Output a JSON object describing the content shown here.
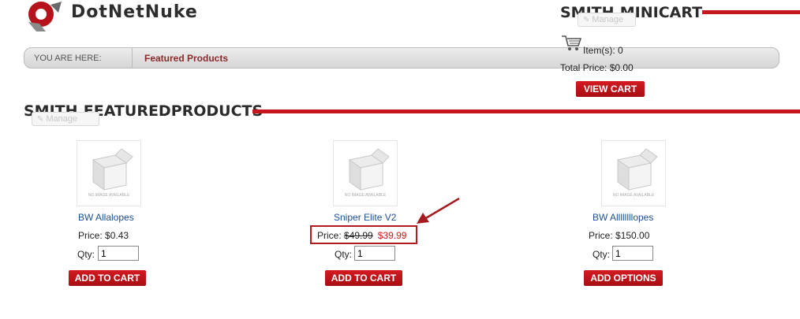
{
  "logo": {
    "text": "DotNetNuke"
  },
  "breadcrumb": {
    "label": "YOU ARE HERE:",
    "current": "Featured Products"
  },
  "minicart": {
    "title": "SMITH.MINICART",
    "manage_label": "Manage",
    "items_text": "Item(s): 0",
    "total_text": "Total Price: $0.00",
    "view_cart_label": "VIEW CART"
  },
  "featured": {
    "title": "SMITH.FEATUREDPRODUCTS",
    "manage_label": "Manage",
    "products": [
      {
        "name": "BW Allalopes",
        "price_label": "Price:",
        "price": "$0.43",
        "qty_label": "Qty:",
        "qty": "1",
        "button": "ADD TO CART"
      },
      {
        "name": "Sniper Elite V2",
        "price_label": "Price:",
        "old_price": "$49.99",
        "sale_price": "$39.99",
        "qty_label": "Qty:",
        "qty": "1",
        "button": "ADD TO CART"
      },
      {
        "name": "BW Allllllllopes",
        "price_label": "Price:",
        "price": "$150.00",
        "qty_label": "Qty:",
        "qty": "1",
        "button": "ADD OPTIONS"
      }
    ],
    "image_caption": "NO IMAGE AVAILABLE"
  },
  "colors": {
    "accent": "#c4161c",
    "link": "#1f4f8f",
    "breadcrumb_link": "#8b2b2b"
  }
}
